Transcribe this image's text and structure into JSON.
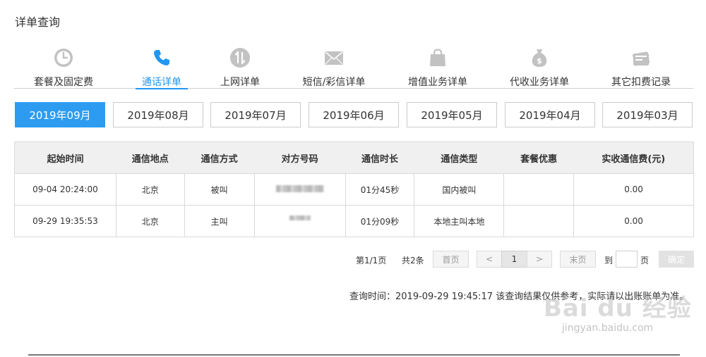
{
  "page": {
    "title": "详单查询"
  },
  "categories": [
    {
      "label": "套餐及固定费",
      "icon": "clock-icon",
      "active": false
    },
    {
      "label": "通话详单",
      "icon": "phone-icon",
      "active": true
    },
    {
      "label": "上网详单",
      "icon": "data-transfer-icon",
      "active": false
    },
    {
      "label": "短信/彩信详单",
      "icon": "envelope-icon",
      "active": false
    },
    {
      "label": "增值业务详单",
      "icon": "shopping-bag-icon",
      "active": false
    },
    {
      "label": "代收业务详单",
      "icon": "money-bag-icon",
      "active": false
    },
    {
      "label": "其它扣费记录",
      "icon": "receipt-icon",
      "active": false
    }
  ],
  "months": [
    "2019年09月",
    "2019年08月",
    "2019年07月",
    "2019年06月",
    "2019年05月",
    "2019年04月",
    "2019年03月"
  ],
  "selected_month": "2019年09月",
  "table": {
    "columns": [
      "起始时间",
      "通信地点",
      "通信方式",
      "对方号码",
      "通信时长",
      "通信类型",
      "套餐优惠",
      "实收通信费(元)"
    ],
    "rows": [
      {
        "start": "09-04 20:24:00",
        "place": "北京",
        "mode": "被叫",
        "number": "",
        "duration": "01分45秒",
        "type": "国内被叫",
        "discount": "",
        "fee": "0.00"
      },
      {
        "start": "09-29 19:35:53",
        "place": "北京",
        "mode": "主叫",
        "number": "",
        "duration": "01分09秒",
        "type": "本地主叫本地",
        "discount": "",
        "fee": "0.00"
      }
    ]
  },
  "pagination": {
    "page_info": "第1/1页",
    "total": "共2条",
    "first": "首页",
    "prev": "<",
    "current": "1",
    "next": ">",
    "last": "末页",
    "goto": "到",
    "page_unit": "页",
    "confirm": "确定"
  },
  "notice": "查询时间：2019-09-29 19:45:17 该查询结果仅供参考，实际请以出账账单为准。",
  "watermark": {
    "main": "Bai du 经验",
    "sub": "jingyan.baidu.com"
  },
  "colors": {
    "accent": "#2d9cf0",
    "icon_gray": "#c2c2c2"
  }
}
